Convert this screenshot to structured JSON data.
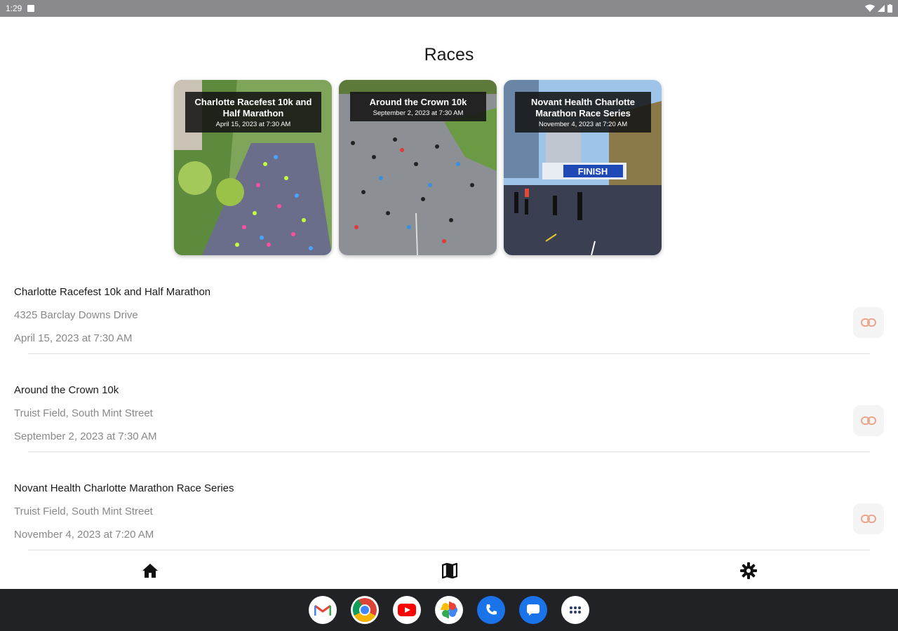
{
  "status_bar": {
    "time": "1:29"
  },
  "page": {
    "title": "Races"
  },
  "cards": [
    {
      "title": "Charlotte Racefest 10k and Half Marathon",
      "date": "April 15, 2023 at 7:30 AM"
    },
    {
      "title": "Around the Crown 10k",
      "date": "September 2, 2023 at 7:30 AM"
    },
    {
      "title": "Novant Health Charlotte Marathon Race Series",
      "date": "November 4, 2023 at 7:20 AM"
    }
  ],
  "races": [
    {
      "name": "Charlotte Racefest 10k and Half Marathon",
      "location": "4325 Barclay Downs Drive",
      "date": "April 15, 2023 at 7:30 AM"
    },
    {
      "name": "Around the Crown 10k",
      "location": "Truist Field, South Mint Street",
      "date": "September 2, 2023 at 7:30 AM"
    },
    {
      "name": "Novant Health Charlotte Marathon Race Series",
      "location": "Truist Field, South Mint Street",
      "date": "November 4, 2023 at 7:20 AM"
    }
  ],
  "card3_banner": "FINISH",
  "nav": {
    "items": [
      "home-icon",
      "map-icon",
      "settings-icon"
    ]
  },
  "dock": {
    "apps": [
      "gmail-icon",
      "chrome-icon",
      "youtube-icon",
      "photos-icon",
      "phone-icon",
      "messages-icon",
      "app-drawer-icon"
    ]
  },
  "colors": {
    "link_icon": "#e8a58f",
    "taskbar": "#212226",
    "status_bar": "#8a8a8e"
  }
}
